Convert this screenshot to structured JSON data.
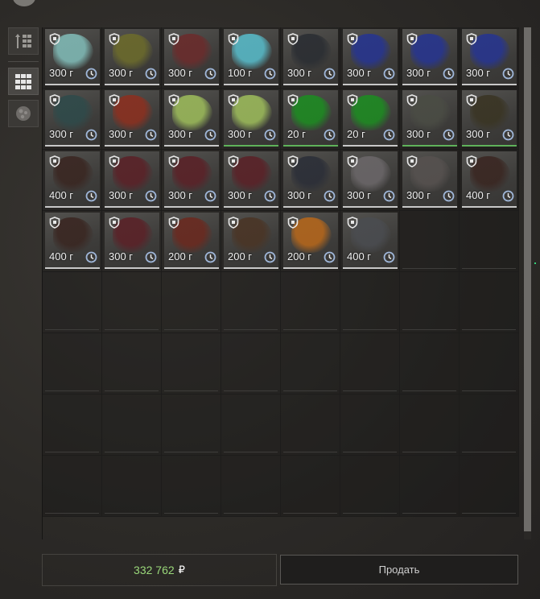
{
  "inventory": {
    "items": [
      {
        "price": "300 г",
        "color": "#7fb8b4",
        "uline": "white"
      },
      {
        "price": "300 г",
        "color": "#6b6a2c",
        "uline": "white"
      },
      {
        "price": "300 г",
        "color": "#6a2c2c",
        "uline": "white"
      },
      {
        "price": "100 г",
        "color": "#57b8c6",
        "uline": "white"
      },
      {
        "price": "300 г",
        "color": "#2b2e33",
        "uline": "white"
      },
      {
        "price": "300 г",
        "color": "#27358e",
        "uline": "white"
      },
      {
        "price": "300 г",
        "color": "#27358e",
        "uline": "white"
      },
      {
        "price": "300 г",
        "color": "#27358e",
        "uline": "white"
      },
      {
        "price": "300 г",
        "color": "#2f4a4a",
        "uline": "white"
      },
      {
        "price": "300 г",
        "color": "#8a3020",
        "uline": "white"
      },
      {
        "price": "300 г",
        "color": "#9ab85a",
        "uline": "white"
      },
      {
        "price": "300 г",
        "color": "#9ab85a",
        "uline": "green"
      },
      {
        "price": "20 г",
        "color": "#1e8a22",
        "uline": "green"
      },
      {
        "price": "20 г",
        "color": "#1e8a22",
        "uline": "white"
      },
      {
        "price": "300 г",
        "color": "#4a4c44",
        "uline": "green"
      },
      {
        "price": "300 г",
        "color": "#3a3524",
        "uline": "green"
      },
      {
        "price": "400 г",
        "color": "#3a2722",
        "uline": "white"
      },
      {
        "price": "300 г",
        "color": "#5a2228",
        "uline": "white"
      },
      {
        "price": "300 г",
        "color": "#5a2228",
        "uline": "white"
      },
      {
        "price": "300 г",
        "color": "#5a2228",
        "uline": "white"
      },
      {
        "price": "300 г",
        "color": "#2c2f38",
        "uline": "white"
      },
      {
        "price": "300 г",
        "color": "#6a6668",
        "uline": "white"
      },
      {
        "price": "300 г",
        "color": "#56514f",
        "uline": "white"
      },
      {
        "price": "400 г",
        "color": "#3a2722",
        "uline": "white"
      },
      {
        "price": "400 г",
        "color": "#3a2722",
        "uline": "white"
      },
      {
        "price": "300 г",
        "color": "#5a2228",
        "uline": "white"
      },
      {
        "price": "200 г",
        "color": "#6a2a20",
        "uline": "white"
      },
      {
        "price": "200 г",
        "color": "#4a3526",
        "uline": "white"
      },
      {
        "price": "200 г",
        "color": "#b3661c",
        "uline": "white"
      },
      {
        "price": "400 г",
        "color": "#4a4c50",
        "uline": "white"
      }
    ],
    "total_cells": 64,
    "columns": 8
  },
  "footer": {
    "money_value": "332 762",
    "money_currency": "₽",
    "sell_label": "Продать"
  },
  "colors": {
    "money": "#9ad87a",
    "accent_green": "#5fb25a"
  },
  "icons": {
    "shield": "shield-icon",
    "clock": "clock-icon",
    "sort": "sort-icon",
    "grid": "grid-icon",
    "artifact": "artifact-icon"
  }
}
